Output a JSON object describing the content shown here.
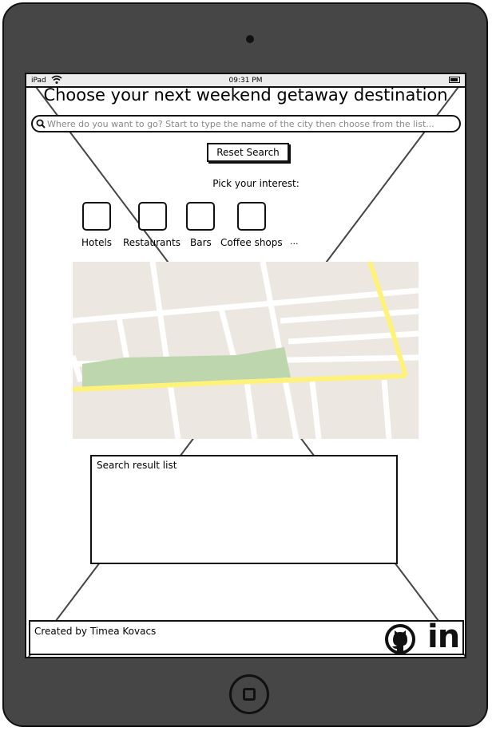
{
  "status_bar": {
    "carrier": "iPad",
    "time": "09:31 PM"
  },
  "header": {
    "title": "Choose your next weekend getaway destination"
  },
  "search": {
    "placeholder": "Where do you want to go? Start to type the name of the city then choose from the list..."
  },
  "reset_button": {
    "label": "Reset Search"
  },
  "interests": {
    "prompt": "Pick your interest:",
    "options": [
      {
        "label": "Hotels",
        "checked": false
      },
      {
        "label": "Restaurants",
        "checked": false
      },
      {
        "label": "Bars",
        "checked": false
      },
      {
        "label": "Coffee shops",
        "checked": false
      }
    ],
    "more": "..."
  },
  "results": {
    "label": "Search result list"
  },
  "footer": {
    "credit": "Created by Timea Kovacs",
    "linkedin_label": "in"
  },
  "icons": [
    "wifi-icon",
    "battery-icon",
    "search-icon",
    "github-icon",
    "linkedin-icon",
    "camera-icon",
    "home-button-icon"
  ],
  "colors": {
    "device": "#464646",
    "map_background": "#ece8e1",
    "map_park": "#bdd6ae",
    "map_road_major": "#fff27a",
    "map_road_minor": "#ffffff"
  }
}
